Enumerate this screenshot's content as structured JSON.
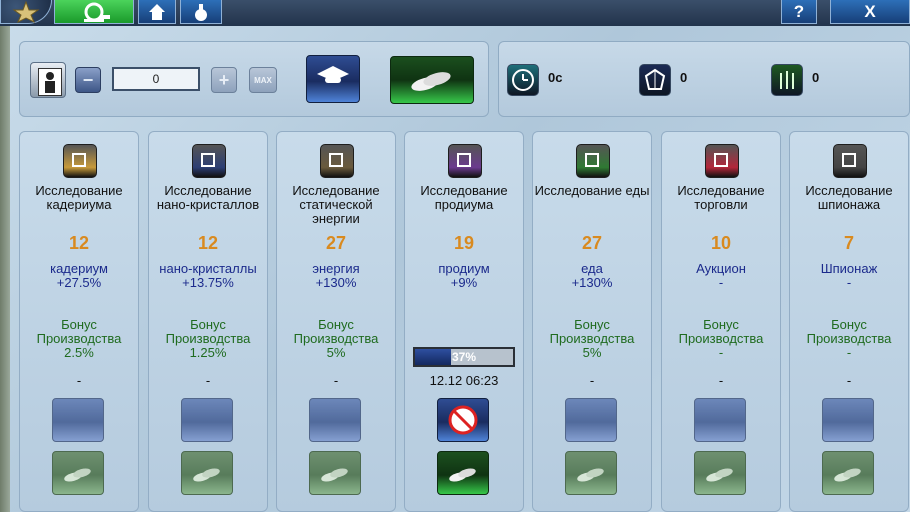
{
  "window": {
    "help_label": "?",
    "close_label": "X",
    "icons": {
      "logo": "star-logo-icon",
      "active_tab": "science-flask-icon",
      "tab_a": "house-icon",
      "tab_b": "potion-icon"
    }
  },
  "controls": {
    "quantity_value": "0",
    "minus_label": "−",
    "plus_label": "+",
    "max_label": "MAX",
    "icons": {
      "unit": "scientist-icon",
      "research": "graduation-cap-icon",
      "build": "coins-icon"
    }
  },
  "stats": [
    {
      "icon": "clock-icon",
      "value": "0c",
      "color": "#1f6f7a"
    },
    {
      "icon": "crystal-icon",
      "value": "0",
      "color": "#1b2a54"
    },
    {
      "icon": "wheat-icon",
      "value": "0",
      "color": "#1f5a22"
    }
  ],
  "research_items": [
    {
      "title": "Исследование кадериума",
      "level": "12",
      "resource": "кадериум",
      "resource_bonus": "+27.5%",
      "bonus_label": "Бонус Производства",
      "bonus_value": "2.5%",
      "status": "-",
      "icon": "cube-icon",
      "icon_color": "#c79a3a"
    },
    {
      "title": "Исследование нано-кристаллов",
      "level": "12",
      "resource": "нано-кристаллы",
      "resource_bonus": "+13.75%",
      "bonus_label": "Бонус Производства",
      "bonus_value": "1.25%",
      "status": "-",
      "icon": "crystal-icon",
      "icon_color": "#2c3e74"
    },
    {
      "title": "Исследование статической энергии",
      "level": "27",
      "resource": "энергия",
      "resource_bonus": "+130%",
      "bonus_label": "Бонус Производства",
      "bonus_value": "5%",
      "status": "-",
      "icon": "lightning-icon",
      "icon_color": "#6a5a3c"
    },
    {
      "title": "Исследование продиума",
      "level": "19",
      "resource": "продиум",
      "resource_bonus": "+9%",
      "bonus_label": "",
      "bonus_value": "",
      "status": "",
      "progress": 0.37,
      "progress_label": "37%",
      "finish_time": "12.12 06:23",
      "icon": "atom-icon",
      "icon_color": "#6b3a8f"
    },
    {
      "title": "Исследование еды",
      "level": "27",
      "resource": "еда",
      "resource_bonus": "+130%",
      "bonus_label": "Бонус Производства",
      "bonus_value": "5%",
      "status": "-",
      "icon": "wheat-icon",
      "icon_color": "#2f7a33"
    },
    {
      "title": "Исследование торговли",
      "level": "10",
      "resource": "Аукцион",
      "resource_bonus": "-",
      "bonus_label": "Бонус Производства",
      "bonus_value": "-",
      "status": "-",
      "icon": "briefcase-icon",
      "icon_color": "#b3263a"
    },
    {
      "title": "Исследование шпионажа",
      "level": "7",
      "resource": "Шпионаж",
      "resource_bonus": "-",
      "bonus_label": "Бонус Производства",
      "bonus_value": "-",
      "status": "-",
      "icon": "binoculars-icon",
      "icon_color": "#444444"
    }
  ]
}
